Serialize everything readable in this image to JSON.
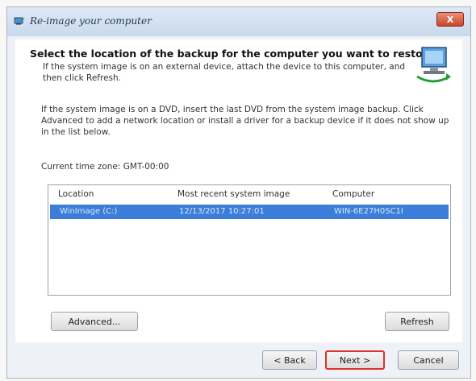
{
  "window": {
    "title": "Re-image your computer",
    "close_label": "X"
  },
  "header": {
    "title": "Select the location of the backup for the computer you want to restore",
    "subtitle": "If the system image is on an external device, attach the device to this computer, and then click Refresh."
  },
  "body": {
    "intro": "If the system image is on a DVD, insert the last DVD from the system image backup. Click Advanced to add a network location or install a driver for a backup device if it does not show up in the list below.",
    "timezone": "Current time zone: GMT-00:00"
  },
  "list": {
    "columns": [
      "Location",
      "Most recent system image",
      "Computer"
    ],
    "rows": [
      {
        "location": "WinImage (C:)",
        "date": "12/13/2017 10:27:01",
        "computer": "WIN-6E27H0SC1I"
      }
    ]
  },
  "buttons": {
    "advanced": "Advanced...",
    "refresh": "Refresh",
    "back": "< Back",
    "next": "Next >",
    "cancel": "Cancel"
  },
  "colors": {
    "selection": "#3b7dd8",
    "next_highlight": "#d9342b"
  }
}
